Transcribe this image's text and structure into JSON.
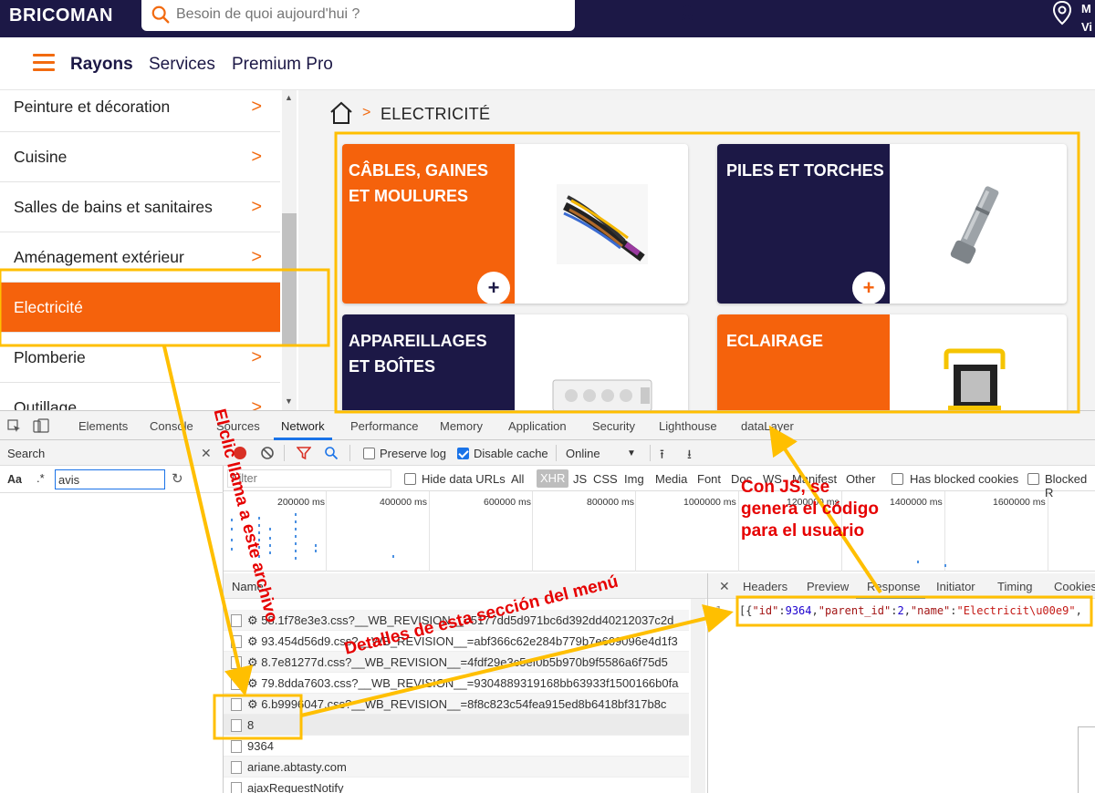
{
  "header": {
    "logo": "BRICOMAN",
    "search_placeholder": "Besoin de quoi aujourd'hui ?",
    "store_line1": "M",
    "store_line2": "Vi"
  },
  "nav": {
    "rayons": "Rayons",
    "services": "Services",
    "premium": "Premium Pro"
  },
  "sidebar": {
    "items": [
      {
        "label": "Peinture et décoration"
      },
      {
        "label": "Cuisine"
      },
      {
        "label": "Salles de bains et sanitaires"
      },
      {
        "label": "Aménagement extérieur"
      },
      {
        "label": "Electricité"
      },
      {
        "label": "Plomberie"
      },
      {
        "label": "Outillage"
      }
    ],
    "chevron": ">",
    "active_index": 4
  },
  "breadcrumb": {
    "separator": ">",
    "current": "ELECTRICITÉ"
  },
  "cards": [
    {
      "title": "CÂBLES, GAINES ET MOULURES",
      "color": "#f5620c",
      "plus": "+",
      "plus_color": "#1c1846"
    },
    {
      "title": "PILES ET TORCHES",
      "color": "#1c1846",
      "plus": "+",
      "plus_color": "#f5620c"
    },
    {
      "title": "APPAREILLAGES ET BOÎTES",
      "color": "#1c1846"
    },
    {
      "title": "ECLAIRAGE",
      "color": "#f5620c"
    }
  ],
  "devtools": {
    "tabs": [
      "Elements",
      "Console",
      "Sources",
      "Network",
      "Performance",
      "Memory",
      "Application",
      "Security",
      "Lighthouse",
      "dataLayer"
    ],
    "active_tab": "Network",
    "search_panel": {
      "title": "Search",
      "case_label": "Aa",
      "regex_label": ".*",
      "query": "avis"
    },
    "toolbar": {
      "preserve_log": "Preserve log",
      "disable_cache": "Disable cache",
      "throttle": "Online"
    },
    "filter": {
      "placeholder": "Filter",
      "hide_data_urls": "Hide data URLs",
      "types": [
        "All",
        "XHR",
        "JS",
        "CSS",
        "Img",
        "Media",
        "Font",
        "Doc",
        "WS",
        "Manifest",
        "Other"
      ],
      "active_type": "XHR",
      "has_blocked": "Has blocked cookies",
      "blocked": "Blocked R"
    },
    "timeline_labels": [
      "200000 ms",
      "400000 ms",
      "600000 ms",
      "800000 ms",
      "1000000 ms",
      "1200000 ms",
      "1400000 ms",
      "1600000 ms"
    ],
    "name_header": "Name",
    "requests": [
      "58.1f78e3e3.css?__WB_REVISION__=5177dd5d971bc6d392dd40212037c2d",
      "93.454d56d9.css?__WB_REVISION__=abf366c62e284b779b7e609096e4d1f3",
      "8.7e81277d.css?__WB_REVISION__=4fdf29e3c5ef0b5b970b9f5586a6f75d5",
      "79.8dda7603.css?__WB_REVISION__=9304889319168bb63933f1500166b0fa",
      "6.b9996047.css?__WB_REVISION__=8f8c823c54fea915ed8b6418bf317b8c",
      "8",
      "9364",
      "ariane.abtasty.com",
      "ajaxRequestNotify"
    ],
    "selected_request": "8",
    "detail_tabs": [
      "Headers",
      "Preview",
      "Response",
      "Initiator",
      "Timing",
      "Cookies"
    ],
    "active_detail_tab": "Response",
    "response_line_no": "1",
    "response": {
      "p1": "[{",
      "k_id": "\"id\"",
      "colon": ":",
      "v_id": "9364",
      "comma": ",",
      "k_parent": "\"parent_id\"",
      "v_parent": "2",
      "k_name": "\"name\"",
      "v_name": "\"Electricit\\u00e9\"",
      "tail": ","
    }
  },
  "annotations": {
    "click_calls_file": "El clic llama a este archivo",
    "section_details": "Detalles de esta sección del menú",
    "js_line1": "Con JS, se",
    "js_line2": "genera el código",
    "js_line3": "para el usuario",
    "color": "#ffbf00",
    "text_color": "#e60000"
  }
}
